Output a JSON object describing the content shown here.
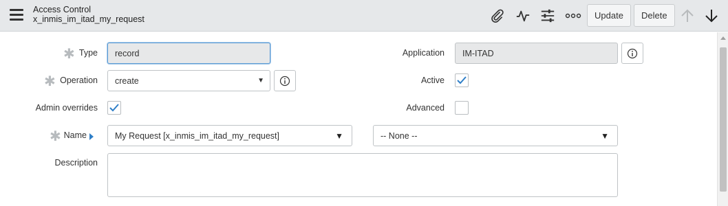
{
  "header": {
    "title": "Access Control",
    "subtitle": "x_inmis_im_itad_my_request",
    "icons": [
      "menu-icon",
      "attachment-icon",
      "activity-icon",
      "settings-sliders-icon",
      "more-options-icon",
      "arrow-up-icon",
      "arrow-down-icon"
    ],
    "update_label": "Update",
    "delete_label": "Delete"
  },
  "form": {
    "type": {
      "label": "Type",
      "value": "record",
      "required": true
    },
    "operation": {
      "label": "Operation",
      "value": "create",
      "required": true
    },
    "admin_overrides": {
      "label": "Admin overrides",
      "checked": true
    },
    "name": {
      "label": "Name",
      "table_value": "My Request [x_inmis_im_itad_my_request]",
      "field_value": "-- None --",
      "required": true
    },
    "description": {
      "label": "Description",
      "value": ""
    },
    "application": {
      "label": "Application",
      "value": "IM-ITAD"
    },
    "active": {
      "label": "Active",
      "checked": true
    },
    "advanced": {
      "label": "Advanced",
      "checked": false
    }
  },
  "colors": {
    "check": "#2f7fc8",
    "required_star": "#b7bbbe",
    "focus": "#5b9bd5",
    "header_bg": "#e6e8ea"
  }
}
